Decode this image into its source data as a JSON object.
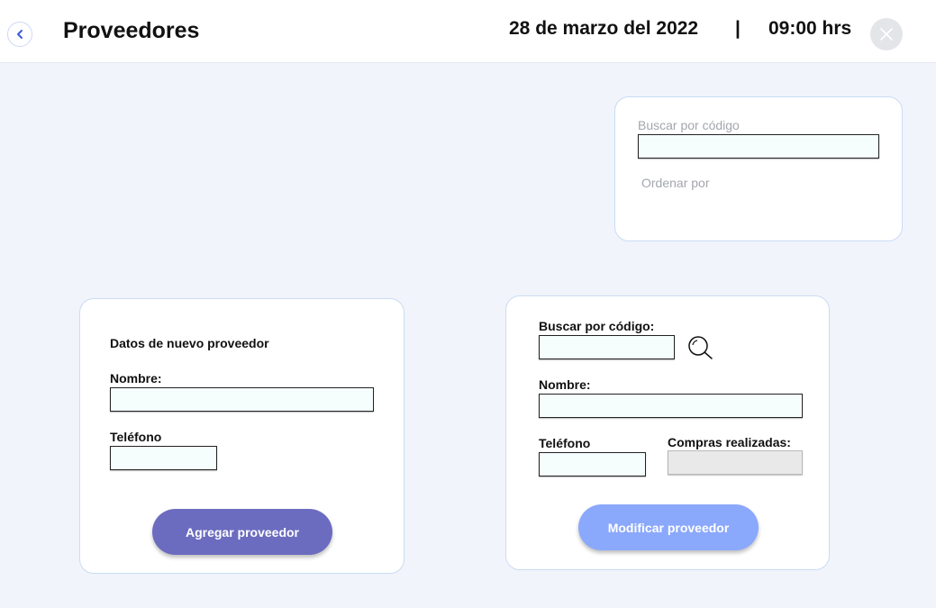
{
  "header": {
    "title": "Proveedores",
    "date": "28 de marzo del 2022",
    "separator": "|",
    "time": "09:00 hrs"
  },
  "filter": {
    "search_label": "Buscar por código",
    "search_value": "",
    "order_label": "Ordenar por"
  },
  "new_supplier": {
    "title": "Datos de nuevo proveedor",
    "name_label": "Nombre:",
    "name_value": "",
    "phone_label": "Teléfono",
    "phone_value": "",
    "button_label": "Agregar proveedor"
  },
  "edit_supplier": {
    "search_label": "Buscar por código:",
    "search_value": "",
    "name_label": "Nombre:",
    "name_value": "",
    "phone_label": "Teléfono",
    "phone_value": "",
    "purchases_label": "Compras realizadas:",
    "purchases_value": "",
    "button_label": "Modificar proveedor"
  },
  "colors": {
    "add_button": "#6b6cbf",
    "modify_button": "#8aa8fc",
    "background": "#f2f4fb",
    "card_border": "#c9dcf4"
  },
  "icons": {
    "back": "chevron-left-icon",
    "close": "close-icon",
    "search": "search-icon"
  }
}
